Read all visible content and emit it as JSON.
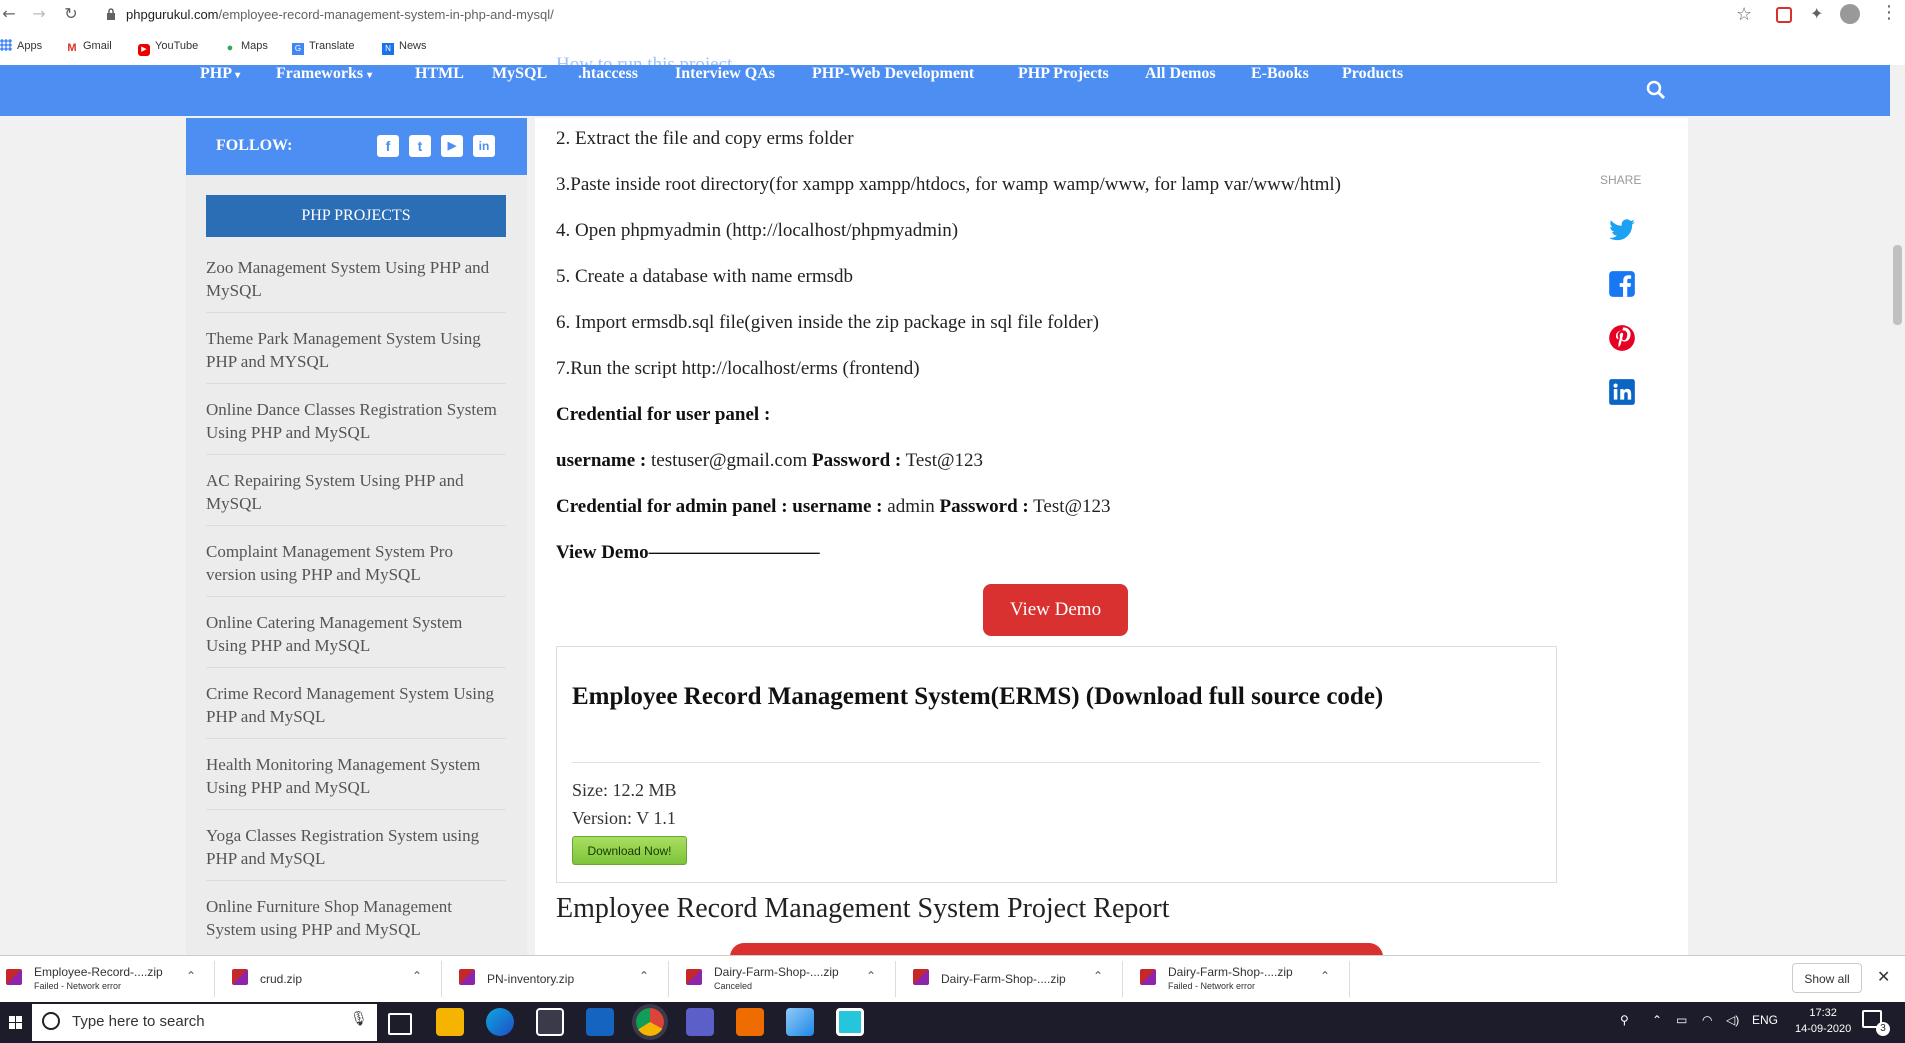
{
  "browser": {
    "url_host": "phpgurukul.com",
    "url_path": "/employee-record-management-system-in-php-and-mysql/",
    "bookmarks": [
      {
        "label": "Apps",
        "icon": "apps-grid-icon"
      },
      {
        "label": "Gmail",
        "icon": "gmail-icon"
      },
      {
        "label": "YouTube",
        "icon": "youtube-icon"
      },
      {
        "label": "Maps",
        "icon": "maps-pin-icon"
      },
      {
        "label": "Translate",
        "icon": "translate-icon"
      },
      {
        "label": "News",
        "icon": "news-icon"
      }
    ]
  },
  "nav": {
    "items": [
      "PHP",
      "Frameworks",
      "HTML",
      "MySQL",
      ".htaccess",
      "Interview QAs",
      "PHP-Web Development",
      "PHP Projects",
      "All Demos",
      "E-Books",
      "Products"
    ],
    "ghost_text": "How to run this project"
  },
  "sidebar": {
    "follow_label": "FOLLOW:",
    "social": [
      "f",
      "t",
      "▶",
      "in"
    ],
    "projects_button": "PHP PROJECTS",
    "projects": [
      "Zoo Management System Using PHP and MySQL",
      "Theme Park Management System Using PHP and MYSQL",
      "Online Dance Classes Registration System Using PHP and MySQL",
      "AC Repairing System Using PHP and MySQL",
      "Complaint Management System Pro version using PHP and MySQL",
      "Online Catering Management System Using PHP and MySQL",
      "Crime Record Management System Using PHP and MySQL",
      "Health Monitoring Management System Using PHP and MySQL",
      "Yoga Classes Registration System using PHP and MySQL",
      "Online Furniture Shop Management System using PHP and MySQL"
    ]
  },
  "content": {
    "steps": [
      "2. Extract the file and copy erms folder",
      "3.Paste inside root directory(for xampp xampp/htdocs, for wamp wamp/www, for lamp var/www/html)",
      "4. Open phpmyadmin (http://localhost/phpmyadmin)",
      "5. Create a database with name ermsdb",
      "6. Import ermsdb.sql file(given inside the zip package in sql file folder)",
      "7.Run the script http://localhost/erms (frontend)"
    ],
    "cred_user_heading": "Credential for user panel :",
    "username_label": "username :",
    "username_value": " testuser@gmail.com ",
    "password_label": "Password :",
    "password_value": " Test@123",
    "cred_admin_heading": "Credential for admin panel : username :",
    "admin_username": " admin ",
    "admin_password_label": "Password :",
    "admin_password_value": " Test@123",
    "view_demo_text": "View Demo—————————",
    "view_demo_button": "View Demo",
    "download": {
      "title": "Employee Record Management System(ERMS) (Download full source code)",
      "size": "Size: 12.2 MB",
      "version": "Version: V 1.1",
      "button": "Download Now!"
    },
    "report_heading": "Employee Record Management System Project Report",
    "share_label": "SHARE"
  },
  "downloads": [
    {
      "name": "Employee-Record-....zip",
      "status": "Failed - Network error"
    },
    {
      "name": "crud.zip",
      "status": ""
    },
    {
      "name": "PN-inventory.zip",
      "status": ""
    },
    {
      "name": "Dairy-Farm-Shop-....zip",
      "status": "Canceled"
    },
    {
      "name": "Dairy-Farm-Shop-....zip",
      "status": ""
    },
    {
      "name": "Dairy-Farm-Shop-....zip",
      "status": "Failed - Network error"
    }
  ],
  "shelf": {
    "show_all": "Show all"
  },
  "taskbar": {
    "search_placeholder": "Type here to search",
    "lang": "ENG",
    "time": "17:32",
    "date": "14-09-2020",
    "notifications": "3"
  },
  "colors": {
    "nav_blue": "#4c8ef2",
    "project_button": "#2b6eb5",
    "demo_red": "#d93030"
  }
}
